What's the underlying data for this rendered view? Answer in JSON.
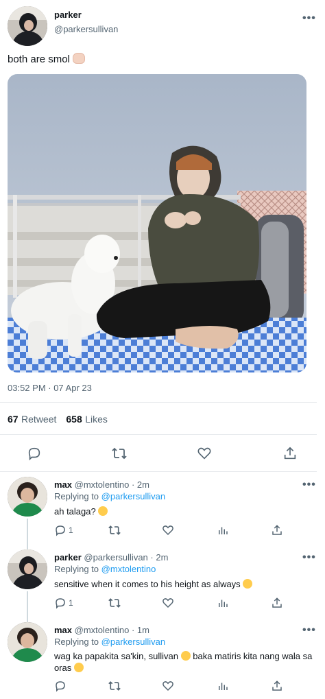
{
  "main_tweet": {
    "name": "parker",
    "handle": "@parkersullivan",
    "text": "both are smol",
    "emoji": "pinching-hand",
    "timestamp": "03:52 PM · 07 Apr 23",
    "retweets_count": "67",
    "retweets_label": "Retweet",
    "likes_count": "658",
    "likes_label": "Likes"
  },
  "replies": [
    {
      "name": "max",
      "handle": "@mxtolentino",
      "time": "· 2m",
      "replying_prefix": "Replying to",
      "replying_to": "@parkersullivan",
      "text": "ah talaga?",
      "emoji": "relieved-face",
      "reply_count": "1"
    },
    {
      "name": "parker",
      "handle": "@parkersullivan",
      "time": "· 2m",
      "replying_prefix": "Replying to",
      "replying_to": "@mxtolentino",
      "text": "sensitive when it comes to his height as always",
      "emoji": "grinning-sweat-face",
      "reply_count": "1"
    },
    {
      "name": "max",
      "handle": "@mxtolentino",
      "time": "· 1m",
      "replying_prefix": "Replying to",
      "replying_to": "@parkersullivan",
      "text_line1": "wag ka papakita sa'kin, sullivan",
      "text_line1b": "baka matiris kita nang wala sa",
      "text_line2": "oras",
      "emoji": "relieved-face",
      "reply_count": ""
    }
  ],
  "colors": {
    "text": "#0f1419",
    "secondary": "#536471",
    "link": "#1d9bf0",
    "divider": "#e6e9ec"
  }
}
